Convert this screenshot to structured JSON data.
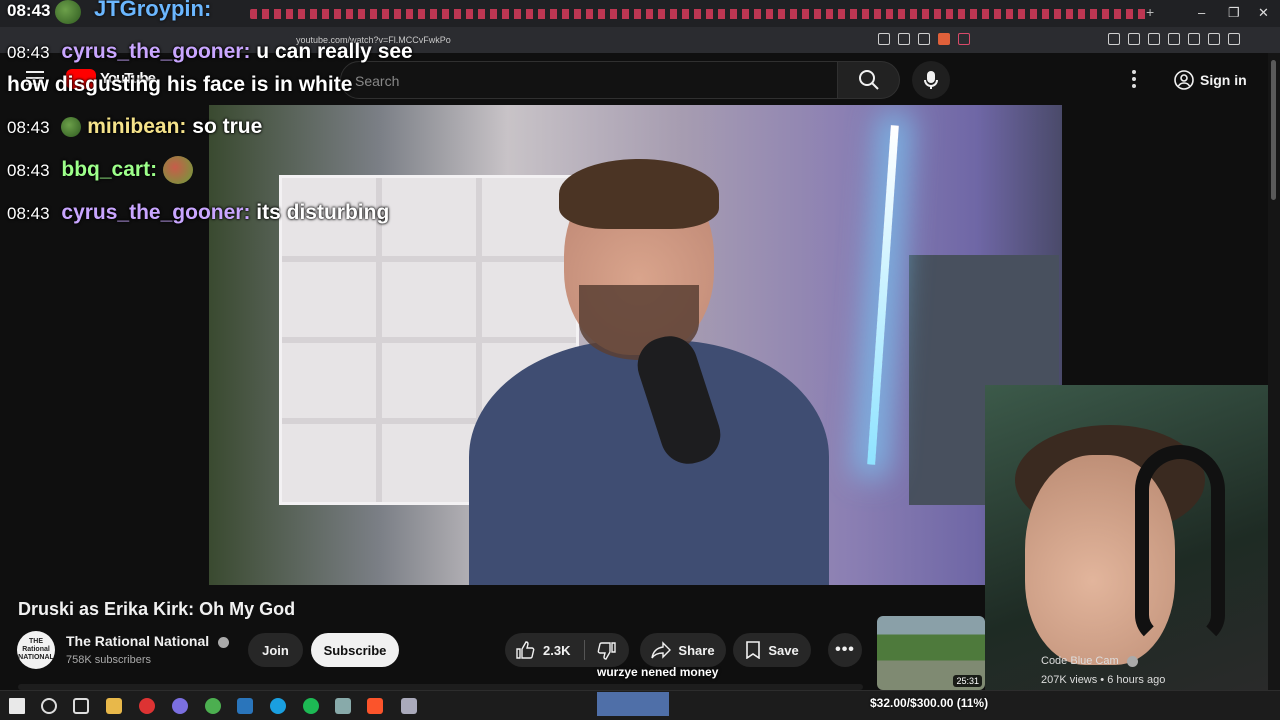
{
  "chat_top": {
    "time": "08:43",
    "user": "JTGroypin:"
  },
  "browser": {
    "url": "youtube.com/watch?v=Fl.MCCvFwkPo",
    "new_tab": "+",
    "window_controls": [
      "–",
      "❐",
      "✕"
    ]
  },
  "youtube": {
    "logo_text": "YouTube",
    "search_placeholder": "Search",
    "sign_in_label": "Sign in"
  },
  "chat": [
    {
      "time": "08:43",
      "user": "cyrus_the_gooner",
      "user_color": "#c9a6ff",
      "message": "u can really see how disgusting his face is in white"
    },
    {
      "time": "08:43",
      "user": "minibean",
      "user_color": "#f4e28a",
      "message": "so true"
    },
    {
      "time": "08:43",
      "user": "bbq_cart",
      "user_color": "#9dff8a",
      "message": ""
    },
    {
      "time": "08:43",
      "user": "cyrus_the_gooner",
      "user_color": "#c9a6ff",
      "message": "its disturbing"
    }
  ],
  "video": {
    "title": "Druski as Erika Kirk: Oh My God",
    "channel_name": "The Rational National",
    "channel_avatar_text": "THE Rational NATIONAL",
    "subscribers": "758K subscribers",
    "join_label": "Join",
    "subscribe_label": "Subscribe",
    "likes": "2.3K",
    "share_label": "Share",
    "save_label": "Save",
    "more_label": "•••"
  },
  "tts_message": "wurzye nened money",
  "recommended": {
    "duration": "25:31",
    "channel": "Code Blue Cam",
    "meta": "207K views • 6 hours ago"
  },
  "donation_goal": {
    "text": "$32.00/$300.00 (11%)",
    "fraction": 0.11
  },
  "colors": {
    "accent_red": "#ff0000",
    "subscribe_bg": "#f1f1f1"
  }
}
